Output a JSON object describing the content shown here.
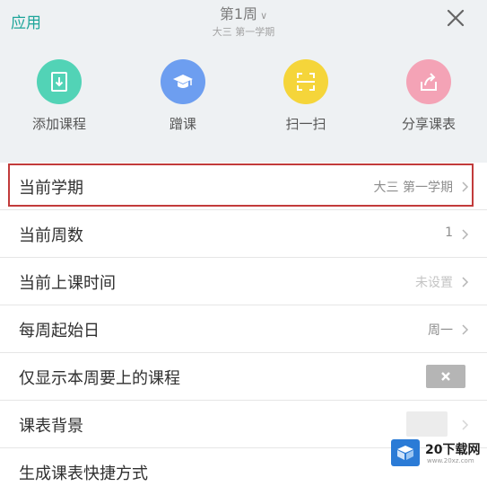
{
  "header": {
    "app_link": "应用",
    "week_title": "第1周",
    "week_subtitle": "大三 第一学期",
    "close_icon": "close-icon"
  },
  "quick_actions": [
    {
      "label": "添加课程",
      "icon": "add-course-icon",
      "color": "#52d3b6"
    },
    {
      "label": "蹭课",
      "icon": "graduation-cap-icon",
      "color": "#6d9ef0"
    },
    {
      "label": "扫一扫",
      "icon": "scan-icon",
      "color": "#f5d53a"
    },
    {
      "label": "分享课表",
      "icon": "share-icon",
      "color": "#f4a3b6"
    }
  ],
  "settings": [
    {
      "label": "当前学期",
      "value": "大三 第一学期"
    },
    {
      "label": "当前周数",
      "value": "1"
    },
    {
      "label": "当前上课时间",
      "value": "未设置"
    },
    {
      "label": "每周起始日",
      "value": "周一"
    },
    {
      "label": "仅显示本周要上的课程",
      "value": ""
    },
    {
      "label": "课表背景",
      "value": ""
    },
    {
      "label": "生成课表快捷方式",
      "value": ""
    }
  ],
  "watermark": {
    "text": "20下载网",
    "url": "www.20xz.com"
  },
  "colors": {
    "accent": "#1ea59a",
    "highlight_border": "#c23b3b"
  }
}
